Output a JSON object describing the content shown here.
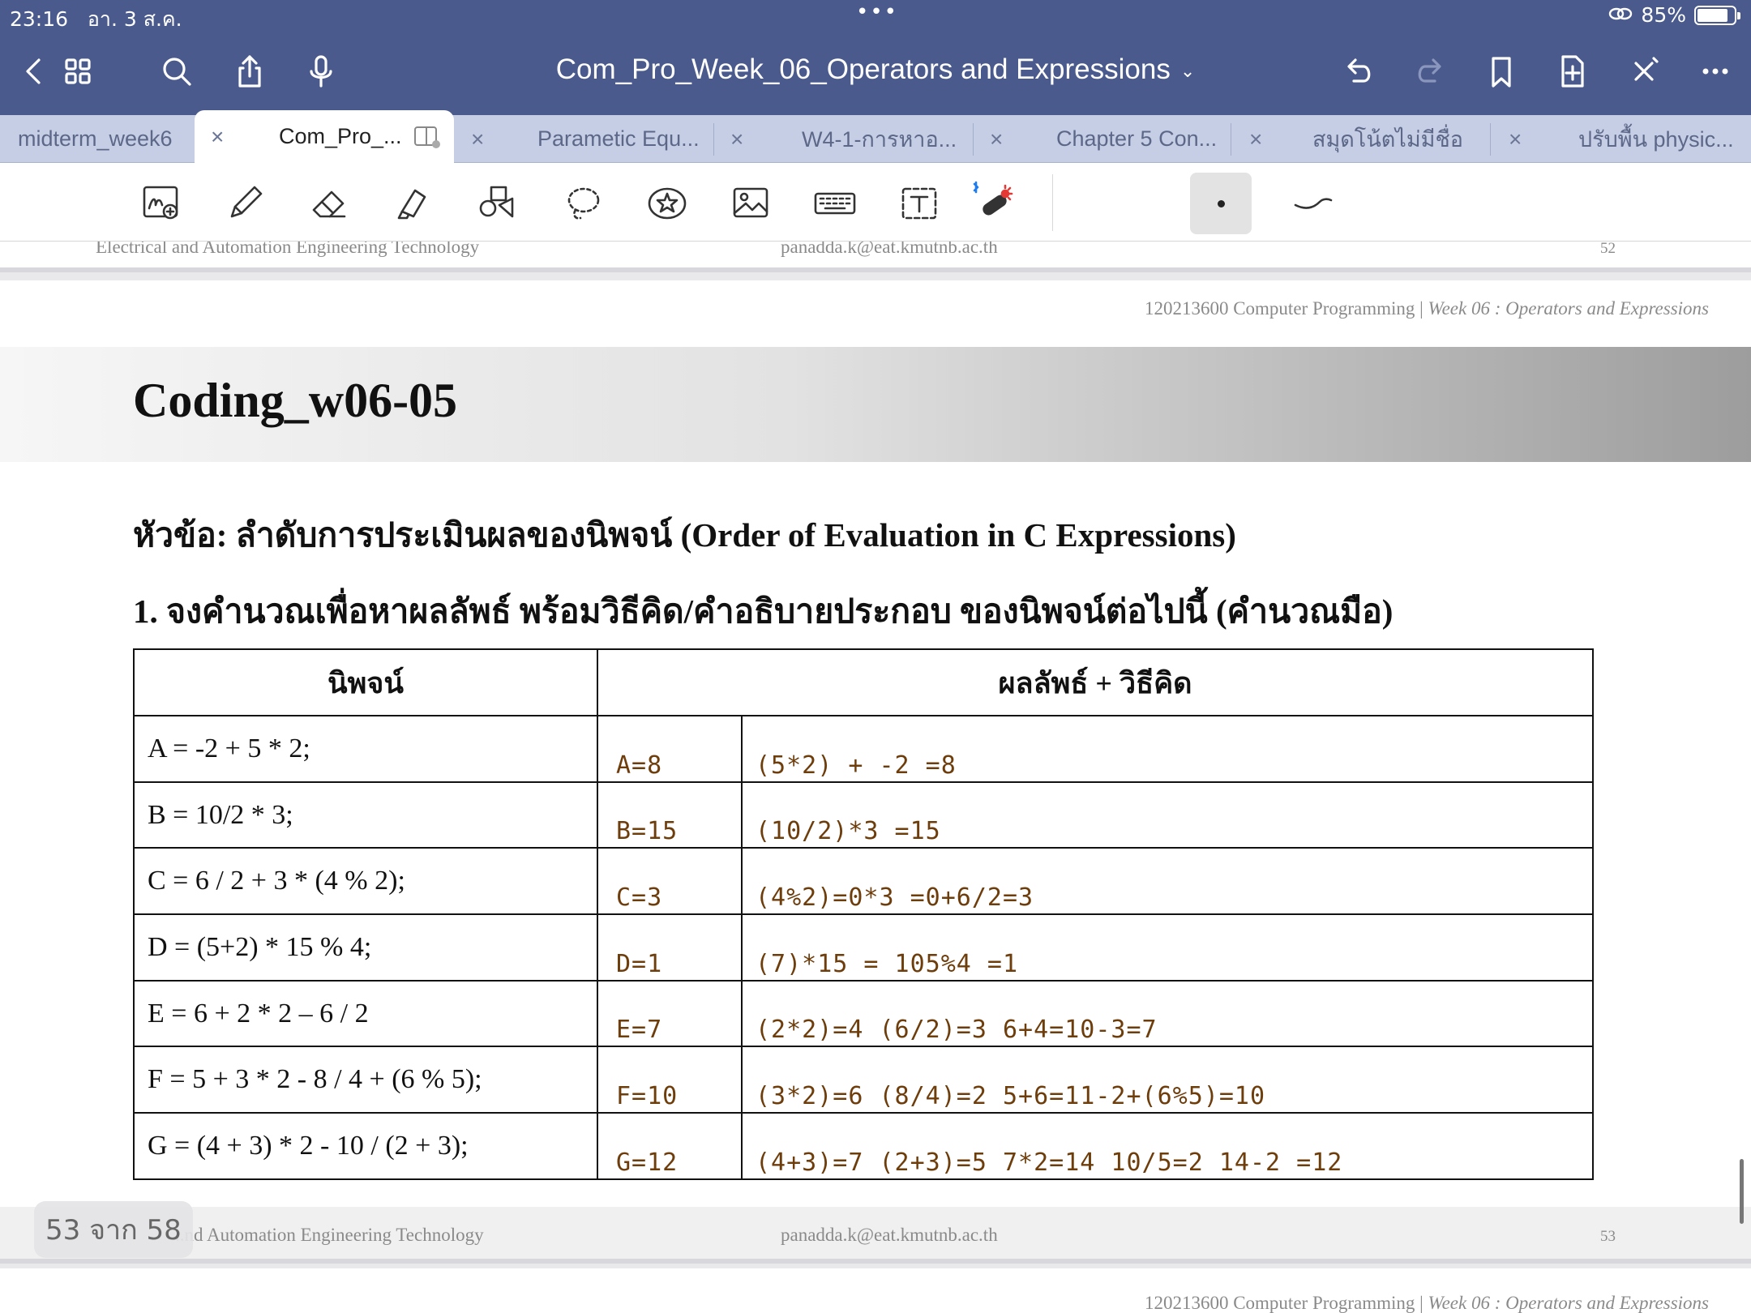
{
  "status": {
    "time": "23:16",
    "date": "อา. 3 ส.ค.",
    "dots": "•••",
    "battery": "85%",
    "battery_fraction": 0.85
  },
  "nav": {
    "title": "Com_Pro_Week_06_Operators and Expressions",
    "title_chevron": "⌄"
  },
  "tabs": [
    {
      "label": "midterm_week6",
      "active": false
    },
    {
      "label": "Com_Pro_...",
      "active": true
    },
    {
      "label": "Parametic Equ...",
      "active": false
    },
    {
      "label": "W4-1-การหาอ...",
      "active": false
    },
    {
      "label": "Chapter 5 Con...",
      "active": false
    },
    {
      "label": "สมุดโน้ตไม่มีชื่อ",
      "active": false
    },
    {
      "label": "ปรับพื้น physic...",
      "active": false
    }
  ],
  "tab_close": "×",
  "toolbar": {
    "icons": [
      "handwriting-zoom-icon",
      "pen-icon",
      "eraser-icon",
      "highlighter-icon",
      "shapes-icon",
      "lasso-icon",
      "sticker-icon",
      "image-icon",
      "keyboard-icon",
      "text-box-icon",
      "laser-pointer-icon"
    ]
  },
  "prev_page_footer": {
    "left": "Electrical and Automation Engineering Technology",
    "mid": "panadda.k@eat.kmutnb.ac.th",
    "num": "52"
  },
  "page": {
    "course": "120213600 Computer Programming | ",
    "course_italic": "Week 06 : Operators and Expressions",
    "banner_title": "Coding_w06-05",
    "topic": "หัวข้อ: ลำดับการประเมินผลของนิพจน์ (Order of Evaluation in C Expressions)",
    "question": "1. จงคำนวณเพื่อหาผลลัพธ์ พร้อมวิธีคิด/คำอธิบายประกอบ ของนิพจน์ต่อไปนี้ (คำนวณมือ)",
    "table_header_expr": "นิพจน์",
    "table_header_result": "ผลลัพธ์ + วิธีคิด",
    "rows": [
      {
        "expr": "A = -2 + 5 * 2;",
        "ans": "A=8",
        "work": "(5*2) + -2 =8"
      },
      {
        "expr": "B = 10/2 * 3;",
        "ans": "B=15",
        "work": "(10/2)*3  =15"
      },
      {
        "expr": "C = 6 / 2 + 3 * (4 % 2);",
        "ans": "C=3",
        "work": "(4%2)=0*3  =0+6/2=3"
      },
      {
        "expr": "D = (5+2) * 15 % 4;",
        "ans": "D=1",
        "work": "(7)*15 = 105%4 =1"
      },
      {
        "expr": "E = 6 + 2 * 2 – 6 / 2",
        "ans": "E=7",
        "work": "(2*2)=4 (6/2)=3  6+4=10-3=7"
      },
      {
        "expr": "F = 5 + 3 * 2 - 8 / 4 + (6 % 5);",
        "ans": "F=10",
        "work": "(3*2)=6 (8/4)=2  5+6=11-2+(6%5)=10"
      },
      {
        "expr": "G = (4 + 3) * 2 - 10 / (2 + 3);",
        "ans": "G=12",
        "work": "(4+3)=7 (2+3)=5  7*2=14  10/5=2  14-2 =12"
      }
    ]
  },
  "page_footer": {
    "left": "..nd Automation Engineering Technology",
    "mid": "panadda.k@eat.kmutnb.ac.th",
    "num": "53"
  },
  "next_page": {
    "course": "120213600 Computer Programming | ",
    "course_italic": "Week 06 : Operators and Expressions"
  },
  "page_indicator": "53 จาก 58"
}
